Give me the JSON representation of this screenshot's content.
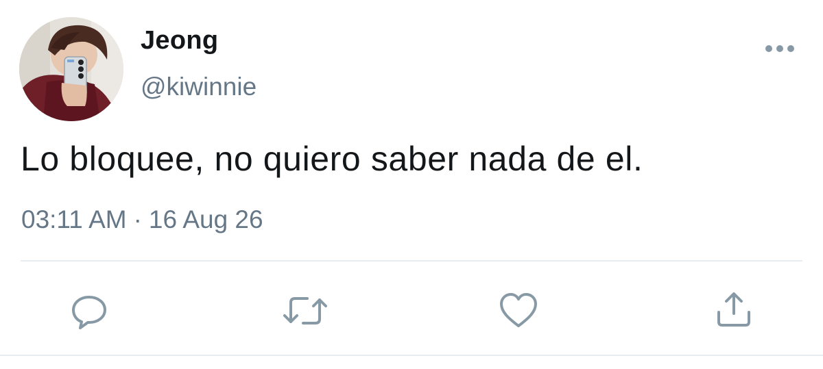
{
  "tweet": {
    "author": {
      "display_name": "Jeong",
      "handle": "@kiwinnie",
      "avatar_icon": "profile-photo"
    },
    "text": "Lo bloquee, no quiero saber nada de el.",
    "time": "03:11 AM",
    "separator": "·",
    "date": "16 Aug 26"
  },
  "actions": {
    "menu_icon": "more-horizontal-icon",
    "reply_icon": "reply-icon",
    "retweet_icon": "retweet-icon",
    "like_icon": "heart-icon",
    "share_icon": "share-icon"
  },
  "colors": {
    "text": "#14171a",
    "secondary": "#657786",
    "icon": "#8899a6",
    "divider": "#e6ecf0"
  }
}
